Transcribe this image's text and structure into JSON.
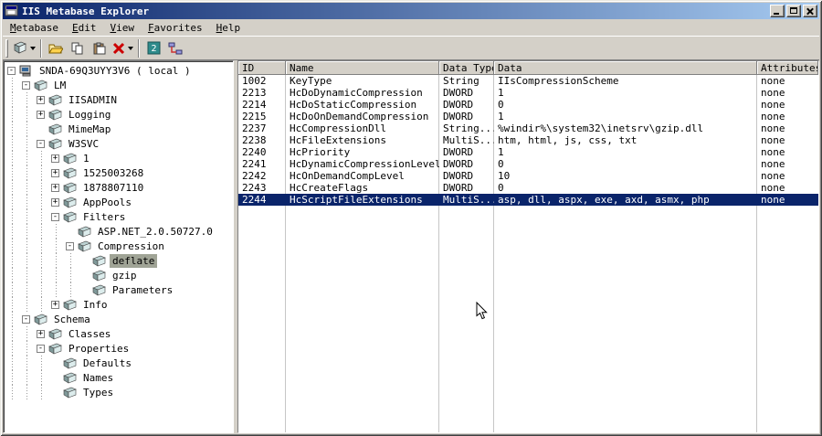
{
  "window": {
    "title": "IIS Metabase Explorer"
  },
  "menu": {
    "items": [
      "Metabase",
      "Edit",
      "View",
      "Favorites",
      "Help"
    ]
  },
  "toolbar": {
    "buttons": [
      "new-key",
      "open",
      "copy",
      "paste",
      "delete",
      "export-2",
      "network"
    ]
  },
  "tree": {
    "items": [
      {
        "label": "SNDA-69Q3UYY3V6 ( local )",
        "level": 0,
        "expand": "minus",
        "icon": "computer",
        "selected": false
      },
      {
        "label": "LM",
        "level": 1,
        "expand": "minus",
        "icon": "node",
        "selected": false
      },
      {
        "label": "IISADMIN",
        "level": 2,
        "expand": "plus",
        "icon": "node",
        "selected": false
      },
      {
        "label": "Logging",
        "level": 2,
        "expand": "plus",
        "icon": "node",
        "selected": false
      },
      {
        "label": "MimeMap",
        "level": 2,
        "expand": "none",
        "icon": "node",
        "selected": false
      },
      {
        "label": "W3SVC",
        "level": 2,
        "expand": "minus",
        "icon": "node",
        "selected": false
      },
      {
        "label": "1",
        "level": 3,
        "expand": "plus",
        "icon": "node",
        "selected": false
      },
      {
        "label": "1525003268",
        "level": 3,
        "expand": "plus",
        "icon": "node",
        "selected": false
      },
      {
        "label": "1878807110",
        "level": 3,
        "expand": "plus",
        "icon": "node",
        "selected": false
      },
      {
        "label": "AppPools",
        "level": 3,
        "expand": "plus",
        "icon": "node",
        "selected": false
      },
      {
        "label": "Filters",
        "level": 3,
        "expand": "minus",
        "icon": "node",
        "selected": false
      },
      {
        "label": "ASP.NET_2.0.50727.0",
        "level": 4,
        "expand": "none",
        "icon": "node",
        "selected": false
      },
      {
        "label": "Compression",
        "level": 4,
        "expand": "minus",
        "icon": "node",
        "selected": false
      },
      {
        "label": "deflate",
        "level": 5,
        "expand": "none",
        "icon": "node",
        "selected": true
      },
      {
        "label": "gzip",
        "level": 5,
        "expand": "none",
        "icon": "node",
        "selected": false
      },
      {
        "label": "Parameters",
        "level": 5,
        "expand": "none",
        "icon": "node",
        "selected": false
      },
      {
        "label": "Info",
        "level": 3,
        "expand": "plus",
        "icon": "node",
        "selected": false
      },
      {
        "label": "Schema",
        "level": 1,
        "expand": "minus",
        "icon": "node",
        "selected": false
      },
      {
        "label": "Classes",
        "level": 2,
        "expand": "plus",
        "icon": "node",
        "selected": false
      },
      {
        "label": "Properties",
        "level": 2,
        "expand": "minus",
        "icon": "node",
        "selected": false
      },
      {
        "label": "Defaults",
        "level": 3,
        "expand": "none",
        "icon": "node",
        "selected": false
      },
      {
        "label": "Names",
        "level": 3,
        "expand": "none",
        "icon": "node",
        "selected": false
      },
      {
        "label": "Types",
        "level": 3,
        "expand": "none",
        "icon": "node",
        "selected": false
      }
    ]
  },
  "table": {
    "columns": [
      "ID",
      "Name",
      "Data Type",
      "Data",
      "Attributes"
    ],
    "rows": [
      [
        "1002",
        "KeyType",
        "String",
        "IIsCompressionScheme",
        "none"
      ],
      [
        "2213",
        "HcDoDynamicCompression",
        "DWORD",
        "1",
        "none"
      ],
      [
        "2214",
        "HcDoStaticCompression",
        "DWORD",
        "0",
        "none"
      ],
      [
        "2215",
        "HcDoOnDemandCompression",
        "DWORD",
        "1",
        "none"
      ],
      [
        "2237",
        "HcCompressionDll",
        "String...",
        "%windir%\\system32\\inetsrv\\gzip.dll",
        "none"
      ],
      [
        "2238",
        "HcFileExtensions",
        "MultiS...",
        "htm, html, js, css, txt",
        "none"
      ],
      [
        "2240",
        "HcPriority",
        "DWORD",
        "1",
        "none"
      ],
      [
        "2241",
        "HcDynamicCompressionLevel",
        "DWORD",
        "0",
        "none"
      ],
      [
        "2242",
        "HcOnDemandCompLevel",
        "DWORD",
        "10",
        "none"
      ],
      [
        "2243",
        "HcCreateFlags",
        "DWORD",
        "0",
        "none"
      ],
      [
        "2244",
        "HcScriptFileExtensions",
        "MultiS...",
        "asp, dll, aspx, exe, axd, asmx, php",
        "none"
      ]
    ],
    "selected_row_index": 10
  },
  "colors": {
    "titlebar_start": "#0a246a",
    "titlebar_end": "#a6caf0",
    "chrome": "#d4d0c8",
    "selection": "#0a246a",
    "inactive_selection": "#a0a496"
  }
}
